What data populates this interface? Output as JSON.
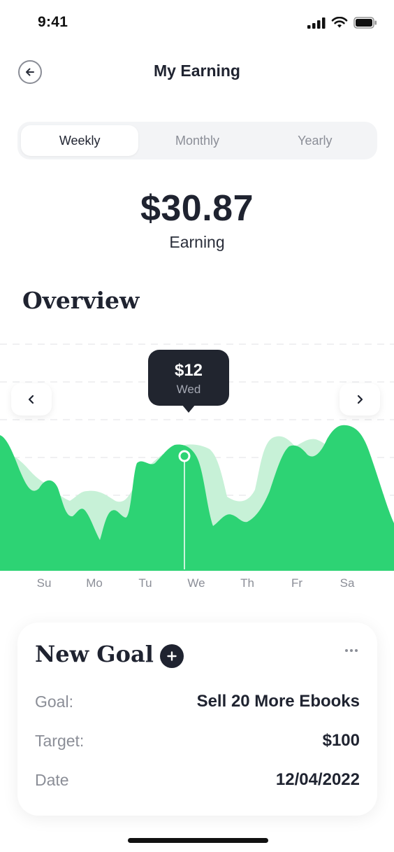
{
  "status_bar": {
    "time": "9:41"
  },
  "header": {
    "title": "My Earning"
  },
  "period_tabs": [
    {
      "label": "Weekly",
      "active": true
    },
    {
      "label": "Monthly",
      "active": false
    },
    {
      "label": "Yearly",
      "active": false
    }
  ],
  "summary": {
    "amount": "$30.87",
    "label": "Earning"
  },
  "overview": {
    "title": "Overview"
  },
  "tooltip": {
    "value": "$12",
    "day": "Wed"
  },
  "chart_data": {
    "type": "area",
    "categories": [
      "Su",
      "Mo",
      "Tu",
      "We",
      "Th",
      "Fr",
      "Sa"
    ],
    "selected_index": 3,
    "colors": {
      "primary": "#2dd374",
      "secondary": "#c7f1d7",
      "tooltip": "#21252f"
    }
  },
  "goal": {
    "title": "New Goal",
    "rows": [
      {
        "key": "Goal:",
        "value": "Sell 20 More Ebooks"
      },
      {
        "key": "Target:",
        "value": "$100"
      },
      {
        "key": "Date",
        "value": "12/04/2022"
      }
    ]
  }
}
